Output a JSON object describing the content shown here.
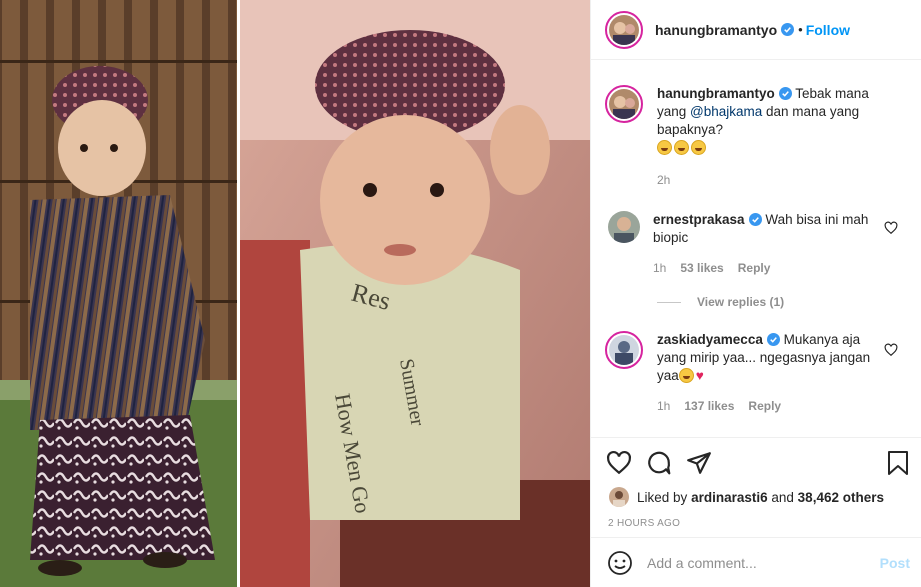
{
  "post": {
    "username": "hanungbramantyo",
    "follow_label": "Follow",
    "dot": "•"
  },
  "caption": {
    "username": "hanungbramantyo",
    "text_before": "Tebak mana yang ",
    "mention": "@bhajkama",
    "text_after": " dan mana yang bapaknya?",
    "emoji_count": 3,
    "time": "2h"
  },
  "comments": [
    {
      "username": "ernestprakasa",
      "text": "Wah bisa ini mah biopic",
      "time": "1h",
      "likes": "53 likes",
      "reply": "Reply"
    },
    {
      "username": "zaskiadyamecca",
      "text": "Mukanya aja yang mirip yaa... ngegasnya jangan yaa",
      "time": "1h",
      "likes": "137 likes",
      "reply": "Reply"
    }
  ],
  "view_replies": "View replies (1)",
  "liked_by": {
    "prefix": "Liked by ",
    "user": "ardinarasti6",
    "middle": " and ",
    "others": "38,462 others"
  },
  "timestamp": "2 HOURS AGO",
  "add_comment": {
    "placeholder": "Add a comment...",
    "post_label": "Post"
  },
  "icons": {
    "like": "heart-icon",
    "comment": "comment-icon",
    "share": "paper-plane-icon",
    "save": "bookmark-icon",
    "emoji": "smiley-icon",
    "verified": "verified-badge-icon"
  },
  "colors": {
    "accent": "#0095f6",
    "verified": "#3897f0",
    "muted": "#8e8e8e",
    "story_ring": "#d6249f"
  }
}
